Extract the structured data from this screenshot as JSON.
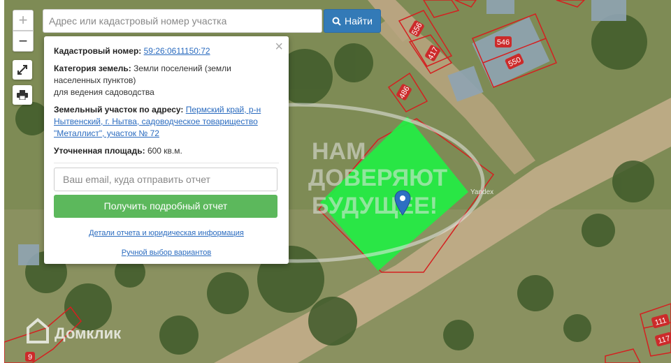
{
  "search": {
    "placeholder": "Адрес или кадастровый номер участка",
    "button_label": "Найти"
  },
  "controls": {
    "zoom_in": "+",
    "zoom_out": "−"
  },
  "popup": {
    "cadastral_label": "Кадастровый номер:",
    "cadastral_value": "59:26:0611150:72",
    "category_label": "Категория земель:",
    "category_value": "Земли поселений (земли населенных пунктов)",
    "category_use": "для ведения садоводства",
    "address_label": "Земельный участок по адресу:",
    "address_value": "Пермский край, р-н Нытвенский, г. Нытва, садоводческое товарищество \"Металлист\", участок № 72",
    "area_label": "Уточненная площадь:",
    "area_value": "600 кв.м.",
    "email_placeholder": "Ваш email, куда отправить отчет",
    "report_button": "Получить подробный отчет",
    "details_link": "Детали отчета и юридическая информация",
    "manual_link": "Ручной выбор вариантов",
    "close": "×"
  },
  "map": {
    "plot_labels": [
      "556",
      "417",
      "546",
      "550",
      "486",
      "111",
      "117",
      "9"
    ],
    "provider": "Yandex",
    "watermark_brand": "Домклик",
    "watermark_lines": [
      "НАМ",
      "ДОВЕРЯЮТ",
      "БУДУЩЕЕ!"
    ],
    "highlight_color": "#22ee44",
    "boundary_color": "#d42020"
  }
}
